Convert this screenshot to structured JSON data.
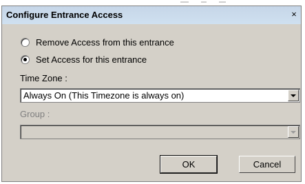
{
  "window": {
    "title": "Configure Entrance Access",
    "close_glyph": "×"
  },
  "options": {
    "remove_access": "Remove Access from this entrance",
    "set_access": "Set Access for this entrance",
    "selected": "set_access"
  },
  "time_zone": {
    "label": "Time Zone :",
    "value": "Always On (This Timezone is always on)"
  },
  "group": {
    "label": "Group :",
    "value": ""
  },
  "buttons": {
    "ok": "OK",
    "cancel": "Cancel"
  },
  "icons": [
    "close-icon",
    "chevron-down-icon"
  ]
}
